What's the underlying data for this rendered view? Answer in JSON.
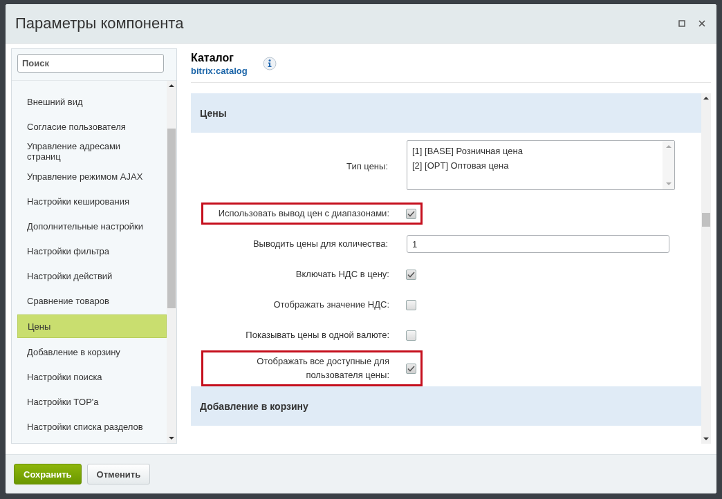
{
  "window": {
    "title": "Параметры компонента"
  },
  "sidebar": {
    "search": {
      "placeholder": "Поиск"
    },
    "items": [
      {
        "label": "Внешний вид",
        "selected": false
      },
      {
        "label": "Согласие пользователя",
        "selected": false
      },
      {
        "label": "Управление адресами страниц",
        "selected": false
      },
      {
        "label": "Управление режимом AJAX",
        "selected": false
      },
      {
        "label": "Настройки кеширования",
        "selected": false
      },
      {
        "label": "Дополнительные настройки",
        "selected": false
      },
      {
        "label": "Настройки фильтра",
        "selected": false
      },
      {
        "label": "Настройки действий",
        "selected": false
      },
      {
        "label": "Сравнение товаров",
        "selected": false
      },
      {
        "label": "Цены",
        "selected": true
      },
      {
        "label": "Добавление в корзину",
        "selected": false
      },
      {
        "label": "Настройки поиска",
        "selected": false
      },
      {
        "label": "Настройки TOP'а",
        "selected": false
      },
      {
        "label": "Настройки списка разделов",
        "selected": false
      }
    ]
  },
  "component": {
    "name": "Каталог",
    "code": "bitrix:catalog"
  },
  "sections": [
    {
      "title": "Цены",
      "fields": [
        {
          "kind": "listbox",
          "label": "Тип цены:",
          "options": [
            "[1] [BASE] Розничная цена",
            "[2] [OPT] Оптовая цена"
          ],
          "highlighted": false
        },
        {
          "kind": "checkbox",
          "label": "Использовать вывод цен с диапазонами:",
          "checked": true,
          "highlighted": true
        },
        {
          "kind": "text",
          "label": "Выводить цены для количества:",
          "value": "1",
          "highlighted": false
        },
        {
          "kind": "checkbox",
          "label": "Включать НДС в цену:",
          "checked": true,
          "highlighted": false
        },
        {
          "kind": "checkbox",
          "label": "Отображать значение НДС:",
          "checked": false,
          "highlighted": false
        },
        {
          "kind": "checkbox",
          "label": "Показывать цены в одной валюте:",
          "checked": false,
          "highlighted": false
        },
        {
          "kind": "checkbox",
          "label": "Отображать все доступные для\nпользователя цены:",
          "checked": true,
          "highlighted": true
        }
      ]
    },
    {
      "title": "Добавление в корзину"
    }
  ],
  "buttons": [
    {
      "label": "Сохранить",
      "kind": "primary"
    },
    {
      "label": "Отменить",
      "kind": "secondary"
    }
  ]
}
